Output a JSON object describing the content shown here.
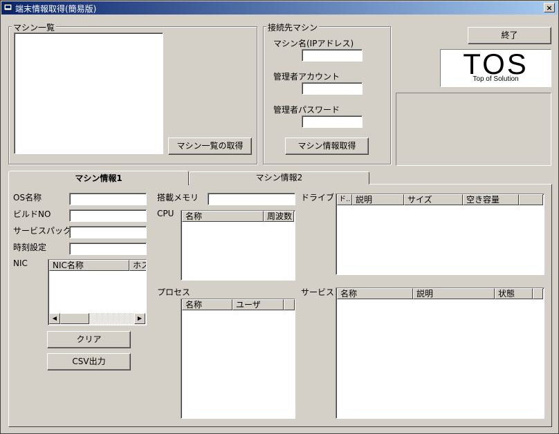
{
  "window": {
    "title": "端末情報取得(簡易版)",
    "close_glyph": "×"
  },
  "machine_list": {
    "label": "マシン一覧",
    "fetch_button": "マシン一覧の取得"
  },
  "connection": {
    "label": "接続先マシン",
    "machine_name_label": "マシン名(IPアドレス)",
    "machine_name_value": "",
    "admin_account_label": "管理者アカウント",
    "admin_account_value": "",
    "admin_password_label": "管理者パスワード",
    "admin_password_value": "",
    "fetch_info_button": "マシン情報取得"
  },
  "exit_button": "終了",
  "logo": {
    "big": "TOS",
    "tagline": "Top of Solution"
  },
  "tabs": [
    {
      "label": "マシン情報1",
      "active": true
    },
    {
      "label": "マシン情報2",
      "active": false
    }
  ],
  "tab1": {
    "os_name_label": "OS名称",
    "build_no_label": "ビルドNO",
    "service_pack_label": "サービスパック",
    "time_setting_label": "時刻設定",
    "nic_label": "NIC",
    "nic_columns": [
      "NIC名称",
      "ホス"
    ],
    "clear_button": "クリア",
    "csv_button": "CSV出力",
    "memory_label": "搭載メモリ",
    "cpu_label": "CPU",
    "cpu_columns": [
      "名称",
      "周波数"
    ],
    "process_label": "プロセス",
    "process_columns": [
      "名称",
      "ユーザ"
    ],
    "drive_label": "ドライブ",
    "drive_columns": [
      "ド..",
      "説明",
      "サイズ",
      "空き容量"
    ],
    "service_label": "サービス",
    "service_columns": [
      "名称",
      "説明",
      "状態"
    ]
  }
}
